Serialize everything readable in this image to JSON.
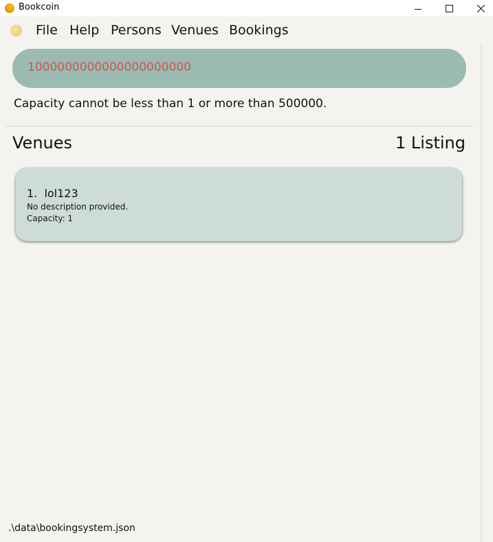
{
  "window": {
    "title": "Bookcoin",
    "controls": [
      "minimize-icon",
      "maximize-icon",
      "close-icon"
    ]
  },
  "menu": {
    "icon": "coin-icon",
    "items": [
      "File",
      "Help",
      "Persons",
      "Venues",
      "Bookings"
    ]
  },
  "command": {
    "value": "1000000000000000000000",
    "color": "#c9584a"
  },
  "result": {
    "message": "Capacity cannot be less than 1 or more than 500000."
  },
  "list": {
    "title": "Venues",
    "count": "1 Listing",
    "items": [
      {
        "index": "1.",
        "name": "lol123",
        "title": "1.  lol123",
        "description": "No description provided.",
        "capacity": "Capacity: 1"
      }
    ]
  },
  "status": {
    "path": ".\\data\\bookingsystem.json"
  },
  "colors": {
    "background": "#f4f3f0",
    "command_box": "#9bbab2",
    "card": "#cedcd8"
  }
}
